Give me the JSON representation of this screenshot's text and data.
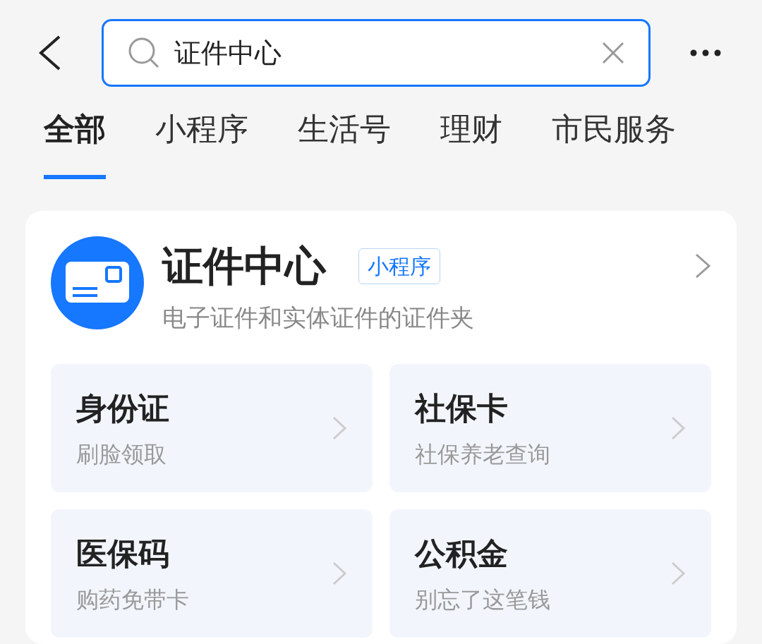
{
  "search": {
    "value": "证件中心"
  },
  "tabs": [
    {
      "label": "全部",
      "selected": true
    },
    {
      "label": "小程序",
      "selected": false
    },
    {
      "label": "生活号",
      "selected": false
    },
    {
      "label": "理财",
      "selected": false
    },
    {
      "label": "市民服务",
      "selected": false
    }
  ],
  "result": {
    "title": "证件中心",
    "badge": "小程序",
    "description": "电子证件和实体证件的证件夹",
    "shortcuts": [
      {
        "title": "身份证",
        "subtitle": "刷脸领取"
      },
      {
        "title": "社保卡",
        "subtitle": "社保养老查询"
      },
      {
        "title": "医保码",
        "subtitle": "购药免带卡"
      },
      {
        "title": "公积金",
        "subtitle": "别忘了这笔钱"
      }
    ]
  }
}
